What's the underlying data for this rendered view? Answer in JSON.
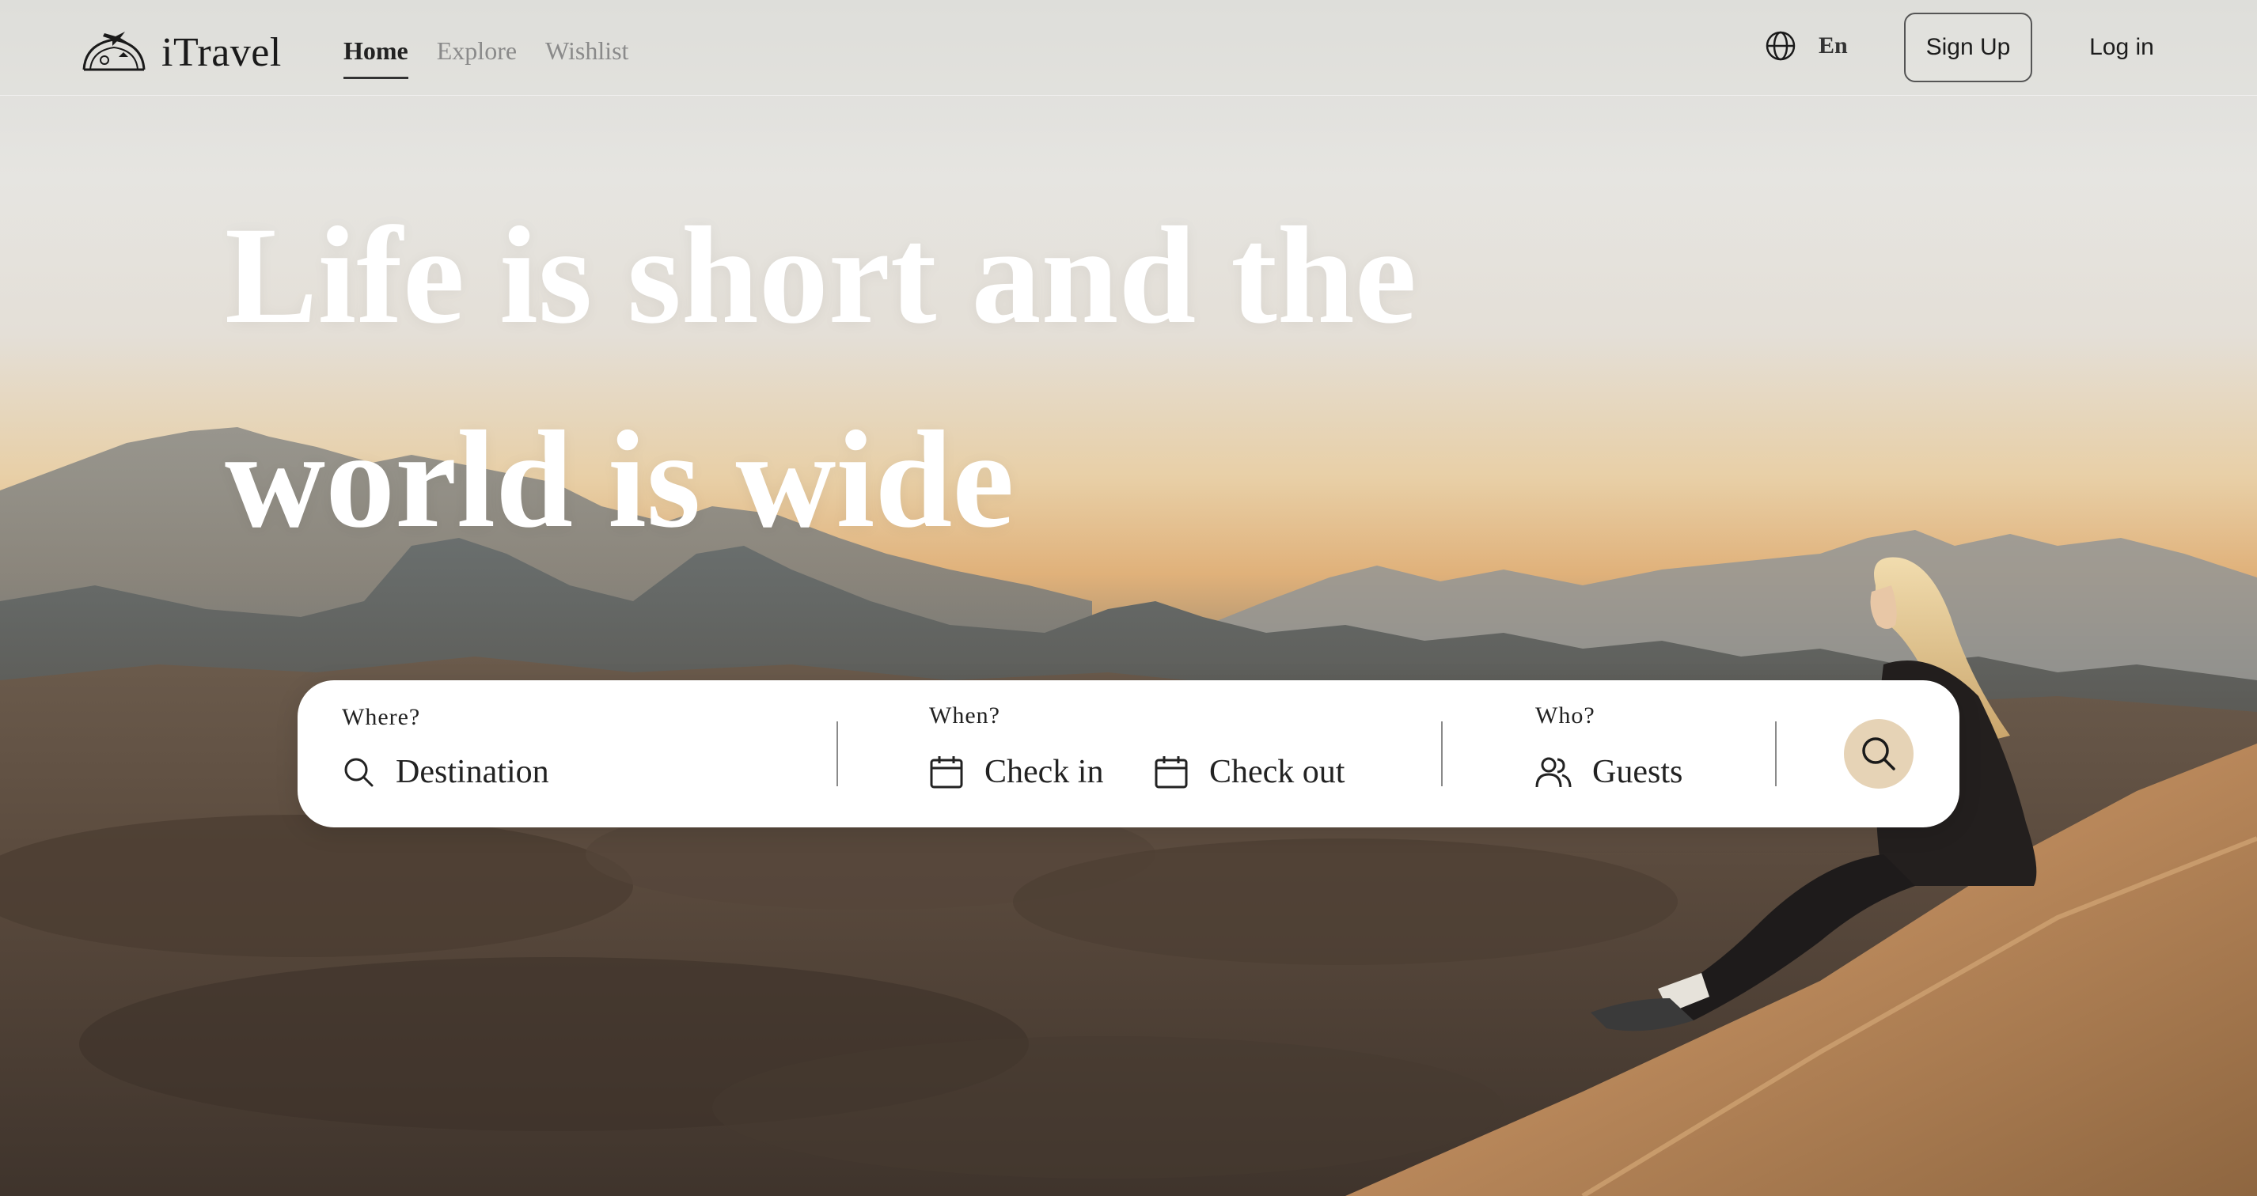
{
  "brand": {
    "name": "iTravel"
  },
  "nav": {
    "links": [
      {
        "label": "Home",
        "active": true
      },
      {
        "label": "Explore",
        "active": false
      },
      {
        "label": "Wishlist",
        "active": false
      }
    ],
    "language": {
      "icon": "globe-icon",
      "label": "En"
    },
    "signup_label": "Sign Up",
    "login_label": "Log in"
  },
  "hero": {
    "line1": "Life is short and the",
    "line2": "world is wide"
  },
  "search": {
    "where": {
      "label": "Where?",
      "placeholder": "Destination",
      "icon": "search-icon"
    },
    "when": {
      "label": "When?",
      "check_in": "Check in",
      "check_out": "Check out",
      "icon": "calendar-icon"
    },
    "who": {
      "label": "Who?",
      "placeholder": "Guests",
      "icon": "users-icon"
    },
    "submit_icon": "search-icon",
    "submit_color": "#e6d3b6"
  },
  "colors": {
    "text_dark": "#1a1a1a",
    "nav_inactive": "#8a8a8a",
    "hero_text": "#ffffff"
  }
}
